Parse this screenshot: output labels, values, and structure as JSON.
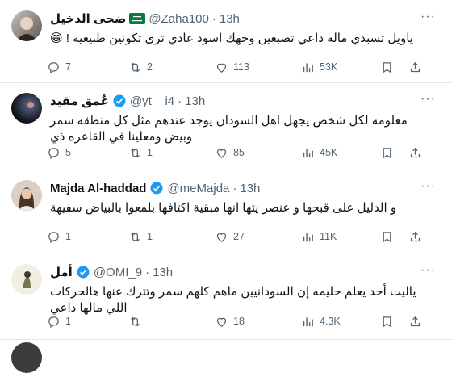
{
  "tweets": [
    {
      "name": "ضحى الدخيل",
      "handle": "@Zaha100",
      "time": "13h",
      "badge": "saudi-flag",
      "text": "ياويل تسبدي ماله داعي تصبغين وجهك اسود عادي ترى تكونين طبيعيه ! 😁",
      "replies": "7",
      "reposts": "2",
      "likes": "113",
      "views": "53K"
    },
    {
      "name": "عُمق مقيد",
      "handle": "@yt__i4",
      "time": "13h",
      "badge": "verified",
      "text": "معلومه  لكل شخص يجهل اهل السودان يوجد عندهم  مثل كل منطقه سمر وبيض ومعلينا في القاعره ذي",
      "replies": "5",
      "reposts": "1",
      "likes": "85",
      "views": "45K"
    },
    {
      "name": "Majda Al-haddad",
      "handle": "@meMajda",
      "time": "13h",
      "badge": "verified",
      "text": "و الدليل على قبحها و عنصر يتها انها مبقية اكتافها بلمعوا بالبياض سفيهة",
      "replies": "1",
      "reposts": "1",
      "likes": "27",
      "views": "11K"
    },
    {
      "name": "أمل",
      "handle": "@OMI_9",
      "time": "13h",
      "badge": "verified",
      "text": "ياليت أحد يعلم حليمه إن السودانيين ماهم كلهم سمر وتترك عنها هالحركات اللي مالها داعي",
      "replies": "1",
      "reposts": "",
      "likes": "18",
      "views": "4.3K"
    }
  ],
  "colors": {
    "text": "#0f1419",
    "secondary": "#536471",
    "verified": "#1d9bf0",
    "divider": "#e3e7ea",
    "saudi_green": "#0b7a3f"
  }
}
